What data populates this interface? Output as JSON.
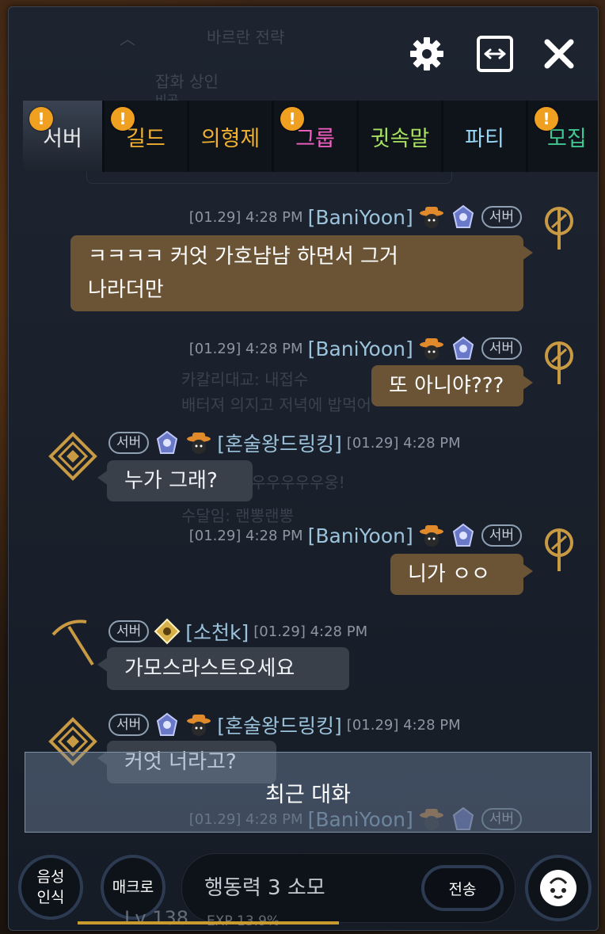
{
  "top_ghost": {
    "collapse_text": "바르란 전략",
    "merchant": "잡화 상인",
    "merchant_sub": "비공"
  },
  "toolbar": {
    "settings_icon": "gear-icon",
    "resize_icon": "expand-horizontal-icon",
    "close_icon": "close-icon"
  },
  "tabs": [
    {
      "label": "서버",
      "color": "#e8e8e8",
      "alert": "!",
      "active": true
    },
    {
      "label": "길드",
      "color": "#f0b030",
      "alert": "!",
      "active": false
    },
    {
      "label": "의형제",
      "color": "#f0b030",
      "alert": "",
      "active": false
    },
    {
      "label": "그룹",
      "color": "#f060c0",
      "alert": "!",
      "active": false
    },
    {
      "label": "귓속말",
      "color": "#a8e060",
      "alert": "",
      "active": false
    },
    {
      "label": "파티",
      "color": "#9ad8f8",
      "alert": "",
      "active": false
    },
    {
      "label": "모집",
      "color": "#40c890",
      "alert": "!",
      "active": false
    }
  ],
  "ghost_lines": [
    "카칼리대교: 내접수",
    "배터져 의지고 저녁에 밥먹어",
    "부우우우우우웅!",
    "수달임: 랜뽕랜뽕"
  ],
  "messages": [
    {
      "side": "mine",
      "time": "[01.29] 4:28 PM",
      "name": "[BaniYoon]",
      "badge": "서버",
      "text1": "ㅋㅋㅋㅋ 커엇 가호냠냠 하면서 그거",
      "text2": "나라더만"
    },
    {
      "side": "mine",
      "time": "[01.29] 4:28 PM",
      "name": "[BaniYoon]",
      "badge": "서버",
      "text1": "또 아니야???"
    },
    {
      "side": "other",
      "time": "[01.29] 4:28 PM",
      "name": "[혼술왕드링킹]",
      "badge": "서버",
      "text1": "누가 그래?"
    },
    {
      "side": "mine",
      "time": "[01.29] 4:28 PM",
      "name": "[BaniYoon]",
      "badge": "서버",
      "text1": "니가 ㅇㅇ"
    },
    {
      "side": "other",
      "time": "[01.29] 4:28 PM",
      "name": "[소천k]",
      "badge": "서버",
      "text1": "가모스라스트오세요"
    },
    {
      "side": "other",
      "time": "[01.29] 4:28 PM",
      "name": "[혼술왕드링킹]",
      "badge": "서버",
      "text1": "커엇 너라고?"
    },
    {
      "side": "mine",
      "time": "[01.29] 4:28 PM",
      "name": "[BaniYoon]",
      "badge": "서버",
      "text1": ""
    }
  ],
  "recent_banner": "최근 대화",
  "bottom": {
    "voice_line1": "음성",
    "voice_line2": "인식",
    "macro": "매크로",
    "input_placeholder": "행동력 3 소모",
    "send": "전송",
    "emote_icon": "emoticon-face-icon",
    "lv": "Lv 138",
    "exp": "EXP 13.9%"
  }
}
